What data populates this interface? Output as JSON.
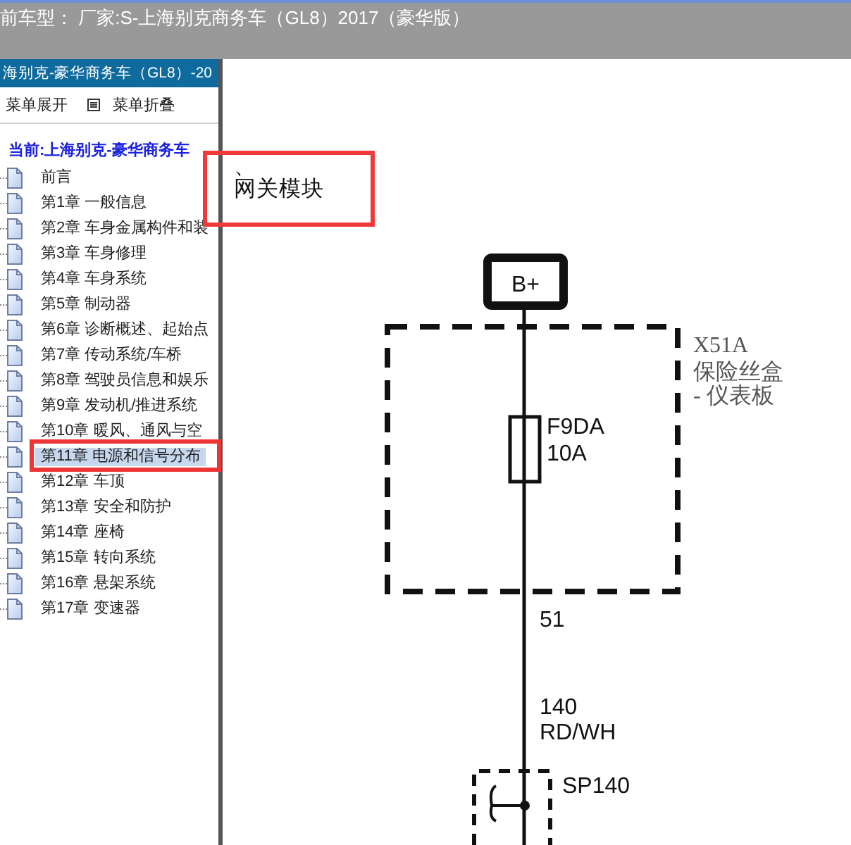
{
  "top_bar": {
    "text": "前车型： 厂家:S-上海别克商务车（GL8）2017（豪华版）"
  },
  "sidebar": {
    "title": "海别克-豪华商务车（GL8）-20",
    "toolbar": [
      {
        "label": "菜单展开",
        "icon": false
      },
      {
        "label": "菜单折叠",
        "icon": true
      }
    ],
    "current": "当前:上海别克-豪华商务车",
    "items": [
      {
        "label": "前言",
        "selected": false,
        "marked": false
      },
      {
        "label": "第1章 一般信息",
        "selected": false,
        "marked": false
      },
      {
        "label": "第2章 车身金属构件和装",
        "selected": false,
        "marked": false
      },
      {
        "label": "第3章 车身修理",
        "selected": false,
        "marked": false
      },
      {
        "label": "第4章 车身系统",
        "selected": false,
        "marked": false
      },
      {
        "label": "第5章 制动器",
        "selected": false,
        "marked": false
      },
      {
        "label": "第6章 诊断概述、起始点",
        "selected": false,
        "marked": false
      },
      {
        "label": "第7章 传动系统/车桥",
        "selected": false,
        "marked": false
      },
      {
        "label": "第8章 驾驶员信息和娱乐",
        "selected": false,
        "marked": false
      },
      {
        "label": "第9章 发动机/推进系统",
        "selected": false,
        "marked": false
      },
      {
        "label": "第10章 暖风、通风与空",
        "selected": false,
        "marked": false
      },
      {
        "label": "第11章 电源和信号分布",
        "selected": true,
        "marked": true
      },
      {
        "label": "第12章 车顶",
        "selected": false,
        "marked": false
      },
      {
        "label": "第13章 安全和防护",
        "selected": false,
        "marked": false
      },
      {
        "label": "第14章 座椅",
        "selected": false,
        "marked": false
      },
      {
        "label": "第15章 转向系统",
        "selected": false,
        "marked": false
      },
      {
        "label": "第16章 悬架系统",
        "selected": false,
        "marked": false
      },
      {
        "label": "第17章 变速器",
        "selected": false,
        "marked": false
      }
    ]
  },
  "note": {
    "lines": [
      "、",
      "网关模块"
    ]
  },
  "diagram": {
    "terminal": "B+",
    "fuse_box": {
      "name": "X51A",
      "lines": [
        "保险丝盒",
        "- 仪表板"
      ]
    },
    "fuse": {
      "name": "F9DA",
      "rating": "10A"
    },
    "cavity": "51",
    "wire": {
      "circuit": "140",
      "color_code": "RD/WH"
    },
    "splice": "SP140"
  }
}
